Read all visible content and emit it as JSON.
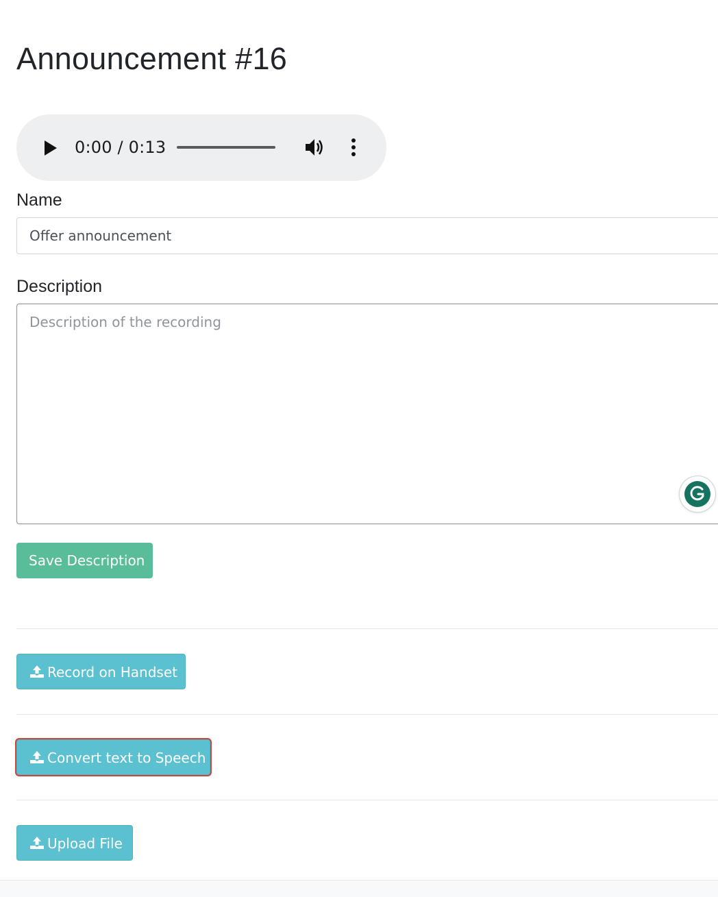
{
  "page": {
    "title": "Announcement #16"
  },
  "audio": {
    "time": "0:00 / 0:13"
  },
  "form": {
    "name_label": "Name",
    "name_value": "Offer announcement",
    "description_label": "Description",
    "description_placeholder": "Description of the recording",
    "save_label": "Save Description"
  },
  "actions": {
    "record_label": "Record on Handset",
    "convert_label": "Convert text to Speech",
    "upload_label": "Upload File"
  },
  "colors": {
    "save_button": "#5abd99",
    "action_button": "#5bc0d0",
    "highlight_outline": "#d0443a",
    "grammarly": "#15735f"
  },
  "icons": {
    "audio": [
      "play-icon",
      "volume-icon",
      "more-options-icon"
    ],
    "actions": "upload-icon",
    "textarea": "grammarly-icon"
  }
}
